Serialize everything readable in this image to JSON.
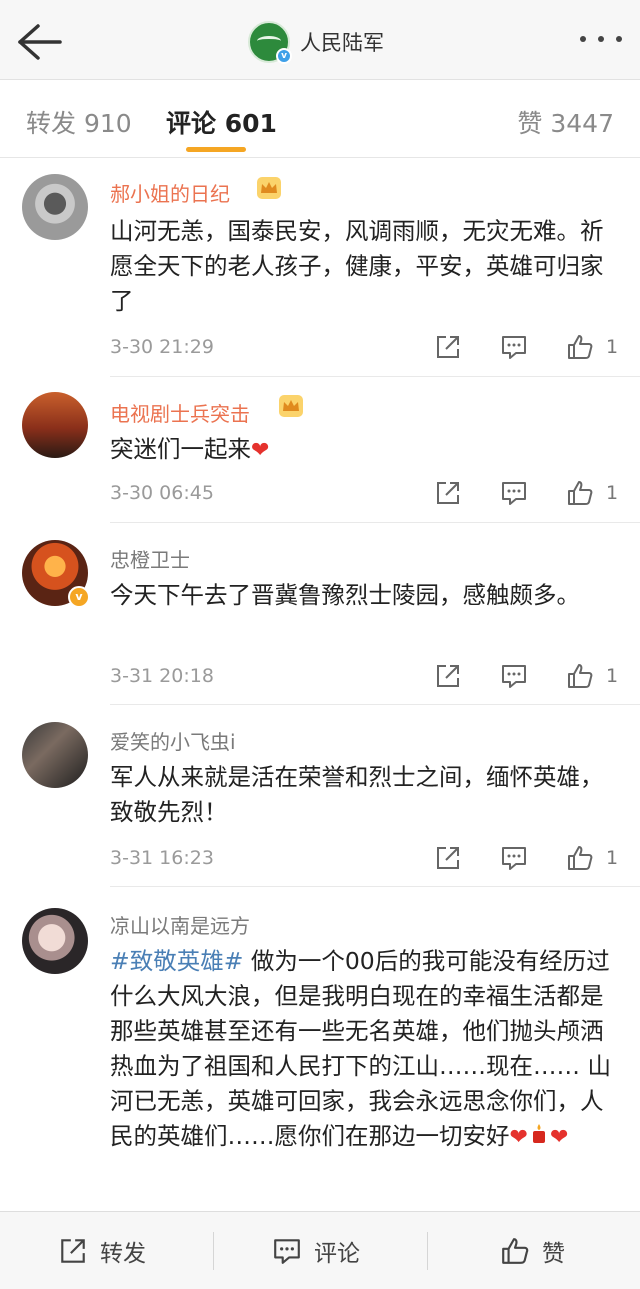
{
  "header": {
    "account_name": "人民陆军",
    "back_icon": "back-arrow-icon",
    "more_icon": "more-dots-icon"
  },
  "tabs": {
    "repost": "转发 910",
    "comment": "评论 601",
    "like": "赞 3447"
  },
  "comments": [
    {
      "user": "郝小姐的日纪",
      "crown": true,
      "text": "山河无恙，国泰民安，风调雨顺，无灾无难。祈愿全天下的老人孩子，健康，平安，英雄可归家了",
      "date": "3-30 21:29",
      "likes": "1"
    },
    {
      "user": "电视剧士兵突击",
      "crown": true,
      "text": "突迷们一起来",
      "date": "3-30 06:45",
      "likes": "1"
    },
    {
      "user": "忠橙卫士",
      "verified": true,
      "text": "今天下午去了晋冀鲁豫烈士陵园，感触颇多。",
      "date": "3-31 20:18",
      "likes": "1"
    },
    {
      "user": "爱笑的小飞虫i",
      "text": "军人从来就是活在荣誉和烈士之间，缅怀英雄，致敬先烈！",
      "date": "3-31 16:23",
      "likes": "1"
    },
    {
      "user": "凉山以南是远方",
      "topic": "#致敬英雄#",
      "text": " 做为一个00后的我可能没有经历过什么大风大浪，但是我明白现在的幸福生活都是那些英雄甚至还有一些无名英雄，他们抛头颅洒热血为了祖国和人民打下的江山……现在…… 山河已无恙，英雄可回家，我会永远思念你们，人民的英雄们……愿你们在那边一切安好"
    }
  ],
  "bottom_bar": {
    "repost": "转发",
    "comment": "评论",
    "like": "赞"
  },
  "colors": {
    "accent": "#f5a623",
    "username_orange": "#eb7350",
    "topic_blue": "#4a7fb5",
    "heart_red": "#e5322d"
  }
}
